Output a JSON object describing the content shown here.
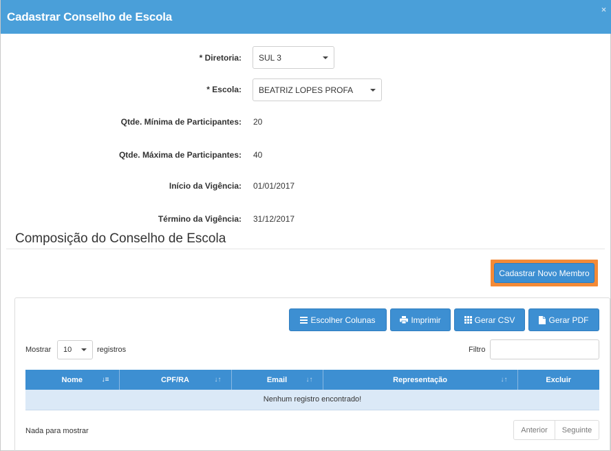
{
  "modal": {
    "title": "Cadastrar Conselho de Escola",
    "close": "×"
  },
  "form": {
    "diretoria_label": "* Diretoria:",
    "diretoria_value": "SUL 3",
    "escola_label": "* Escola:",
    "escola_value": "BEATRIZ LOPES PROFA",
    "min_label": "Qtde. Mínima de Participantes:",
    "min_value": "20",
    "max_label": "Qtde. Máxima de Participantes:",
    "max_value": "40",
    "inicio_label": "Início da Vigência:",
    "inicio_value": "01/01/2017",
    "termino_label": "Término da Vigência:",
    "termino_value": "31/12/2017"
  },
  "section": {
    "title": "Composição do Conselho de Escola",
    "new_member_button": "Cadastrar Novo Membro"
  },
  "toolbar": {
    "columns_button": "Escolher Colunas",
    "print_button": "Imprimir",
    "csv_button": "Gerar CSV",
    "pdf_button": "Gerar PDF"
  },
  "table_controls": {
    "show_label": "Mostrar",
    "page_length": "10",
    "records_label": "registros",
    "filter_label": "Filtro"
  },
  "table": {
    "columns": [
      "Nome",
      "CPF/RA",
      "Email",
      "Representação",
      "Excluir"
    ],
    "empty_message": "Nenhum registro encontrado!"
  },
  "footer": {
    "info": "Nada para mostrar",
    "prev": "Anterior",
    "next": "Seguinte"
  },
  "colors": {
    "header": "#4a9fd9",
    "primary": "#3d8fd2",
    "highlight": "#f48a36",
    "row": "#dbe9f7"
  }
}
